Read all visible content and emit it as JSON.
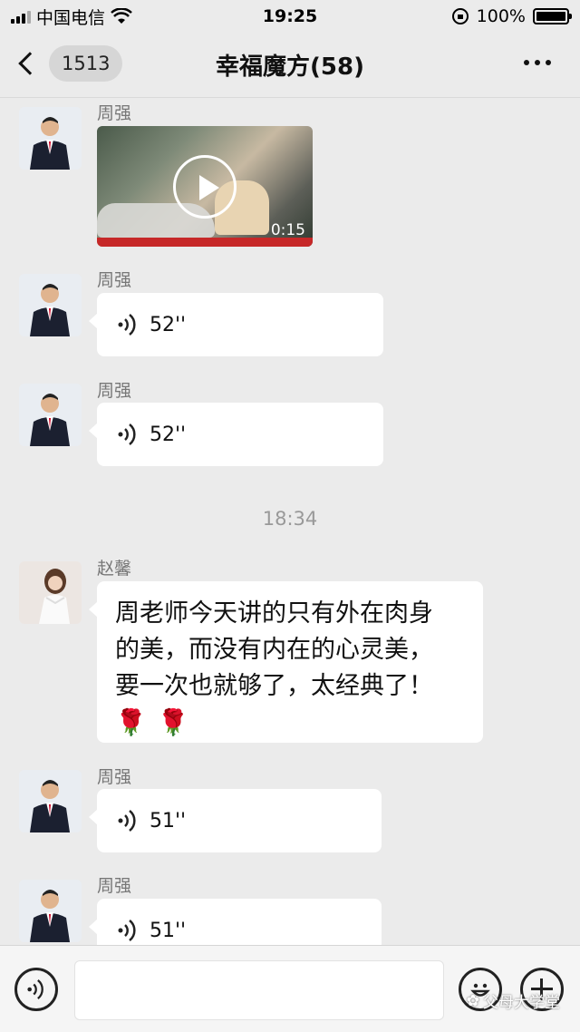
{
  "status_bar": {
    "carrier": "中国电信",
    "time": "19:25",
    "battery": "100%"
  },
  "nav": {
    "unread_count": "1513",
    "title": "幸福魔方(58)"
  },
  "messages": [
    {
      "sender": "周强",
      "type": "video",
      "duration": "0:15",
      "avatar": "man-in-suit"
    },
    {
      "sender": "周强",
      "type": "voice",
      "duration": "52''",
      "avatar": "man-in-suit"
    },
    {
      "sender": "周强",
      "type": "voice",
      "duration": "52''",
      "avatar": "man-in-suit"
    },
    {
      "sender": "赵馨",
      "type": "text",
      "text_lines": [
        "周老师今天讲的只有外在肉身",
        "的美，而没有内在的心灵美，",
        "要一次也就够了，太经典了！"
      ],
      "emoji": "🌹🌹",
      "avatar": "woman-in-white"
    },
    {
      "sender": "周强",
      "type": "voice",
      "duration": "51''",
      "avatar": "man-in-suit"
    },
    {
      "sender": "周强",
      "type": "voice",
      "duration": "51''",
      "avatar": "man-in-suit"
    }
  ],
  "time_divider": "18:34",
  "watermark": "父母大学堂",
  "colors": {
    "chat_bg": "#ebebeb",
    "bubble": "#ffffff",
    "sender_name": "#777777"
  }
}
